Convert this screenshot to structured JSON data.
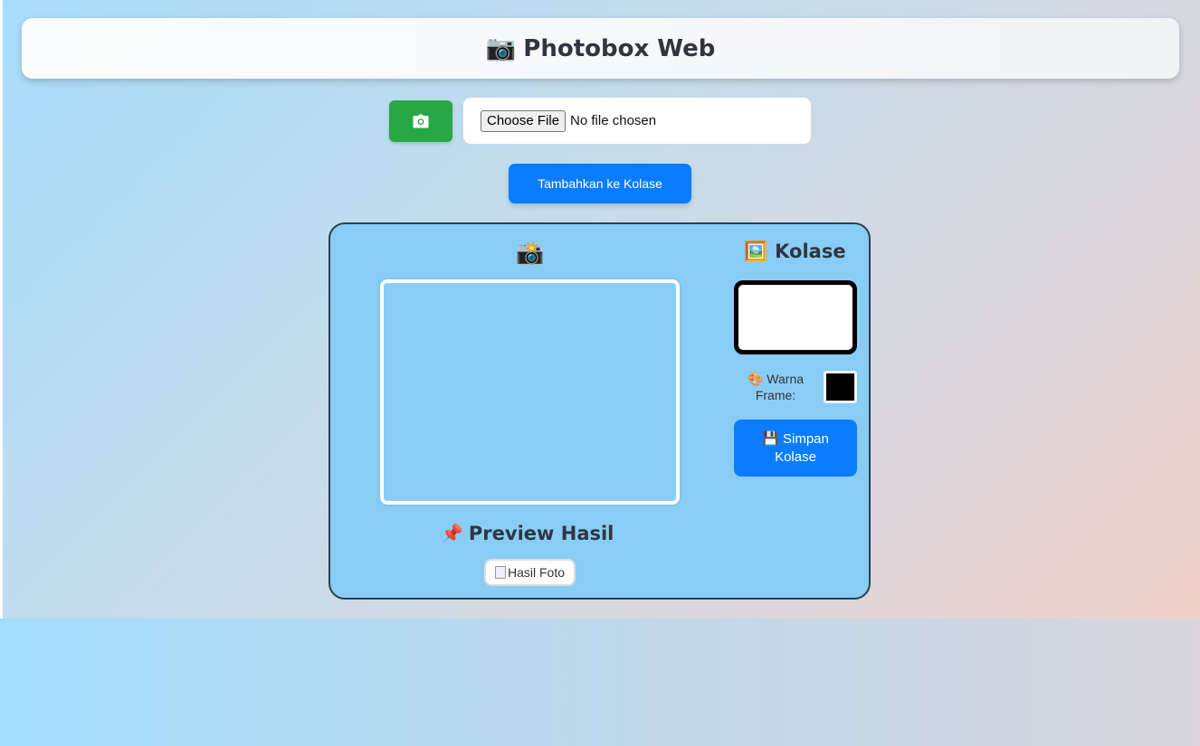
{
  "header": {
    "icon": "camera-emoji",
    "title": "Photobox Web"
  },
  "controls": {
    "camera_button_icon": "camera-icon",
    "file_button_label": "Choose File",
    "file_status": "No file chosen",
    "add_button_label": "Tambahkan ke Kolase"
  },
  "preview": {
    "camera_icon": "camera-flash-emoji",
    "title": "Preview Hasil",
    "pin_icon": "pushpin-emoji",
    "result_alt": "Hasil Foto"
  },
  "collage": {
    "title": "Kolase",
    "frame_icon": "framed-picture-emoji",
    "color_label_line1": "Warna",
    "color_label_line2": "Frame:",
    "frame_color": "#000000",
    "save_label_line1": "Simpan",
    "save_label_line2": "Kolase"
  },
  "colors": {
    "primary": "#0a7cff",
    "success": "#28a745",
    "panel": "#89cdf7"
  }
}
